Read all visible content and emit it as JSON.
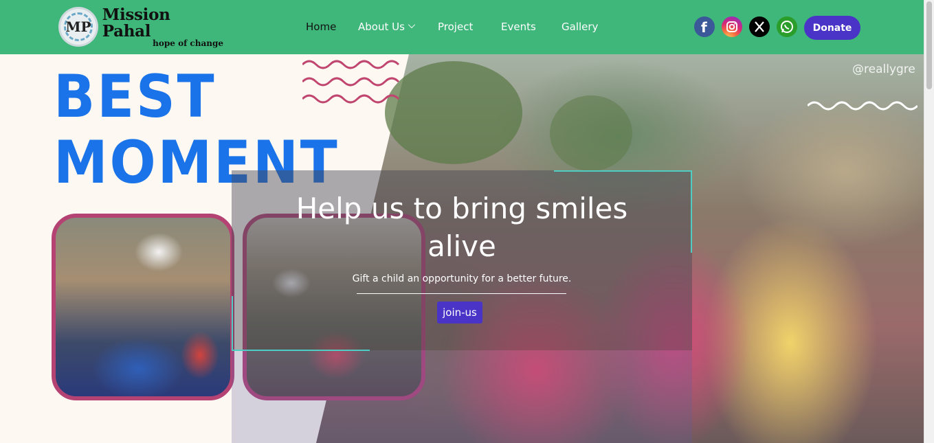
{
  "brand": {
    "name": "Mission Pahal",
    "tagline": "hope of change",
    "logo_initials": "MP"
  },
  "nav": {
    "items": [
      {
        "label": "Home"
      },
      {
        "label": "About Us"
      },
      {
        "label": "Project"
      },
      {
        "label": "Events"
      },
      {
        "label": "Gallery"
      }
    ]
  },
  "social": {
    "icons": [
      "facebook-icon",
      "instagram-icon",
      "x-icon",
      "whatsapp-icon"
    ]
  },
  "donate_label": "Donate",
  "hero": {
    "best": "BEST",
    "moment": "MOMENT",
    "watermark": "@reallygre",
    "headline_line1": "Help us to bring smiles",
    "headline_line2": "alive",
    "subtext": "Gift a child an opportunity for a better future.",
    "cta_label": "join-us"
  },
  "colors": {
    "navbar": "#3fb67a",
    "accent": "#4a34c8",
    "headline_blue": "#1a73e8",
    "frame": "#b44374",
    "teal": "#4ecdc4"
  }
}
